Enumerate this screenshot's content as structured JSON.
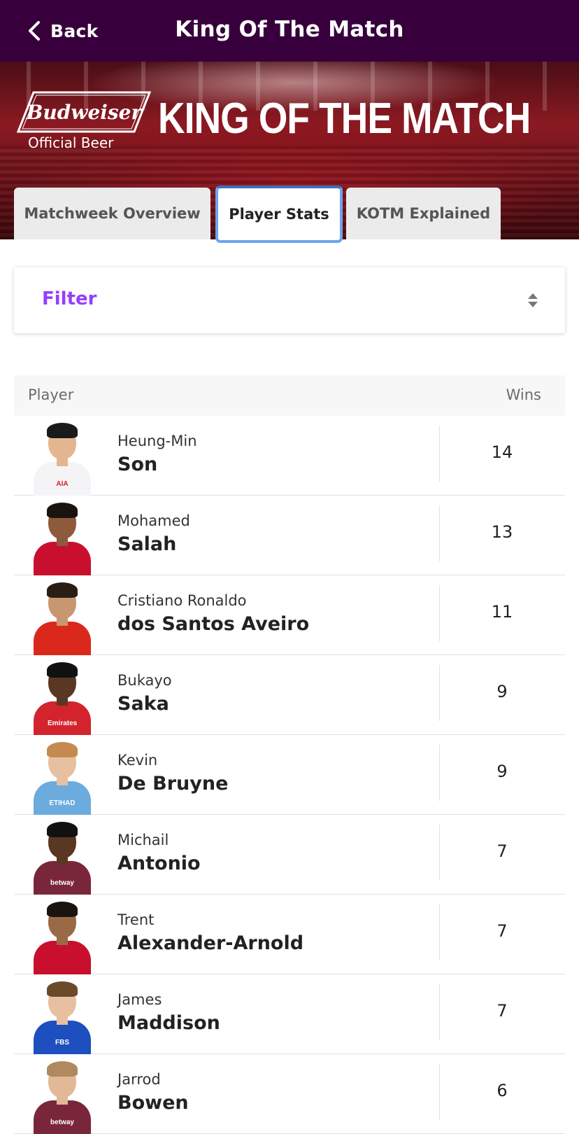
{
  "header": {
    "back_label": "Back",
    "title": "King Of The Match"
  },
  "banner": {
    "brand_name": "Budweiser",
    "brand_subtitle": "Official Beer",
    "heading": "KING OF THE MATCH"
  },
  "tabs": [
    {
      "label": "Matchweek Overview",
      "active": false
    },
    {
      "label": "Player Stats",
      "active": true
    },
    {
      "label": "KOTM Explained",
      "active": false
    }
  ],
  "filter": {
    "label": "Filter",
    "icon": "sort-icon"
  },
  "table": {
    "columns": {
      "player": "Player",
      "wins": "Wins"
    },
    "rows": [
      {
        "first_name": "Heung-Min",
        "last_name": "Son",
        "wins": "14",
        "kit_color": "#f4f4f6",
        "skin": "#e3b690",
        "hair": "#1a1a1a",
        "sponsor": "AIA",
        "sponsor_color": "#d6202f"
      },
      {
        "first_name": "Mohamed",
        "last_name": "Salah",
        "wins": "13",
        "kit_color": "#c8102e",
        "skin": "#8d5a3b",
        "hair": "#1a1410",
        "sponsor": "",
        "sponsor_color": "#ffffff"
      },
      {
        "first_name": "Cristiano Ronaldo",
        "last_name": "dos Santos Aveiro",
        "wins": "11",
        "kit_color": "#da291c",
        "skin": "#c99672",
        "hair": "#2a1d14",
        "sponsor": "",
        "sponsor_color": "#ffffff"
      },
      {
        "first_name": "Bukayo",
        "last_name": "Saka",
        "wins": "9",
        "kit_color": "#d3232c",
        "skin": "#5a3722",
        "hair": "#111111",
        "sponsor": "Emirates",
        "sponsor_color": "#ffffff"
      },
      {
        "first_name": "Kevin",
        "last_name": "De Bruyne",
        "wins": "9",
        "kit_color": "#6cabdd",
        "skin": "#e6c0a0",
        "hair": "#c58a50",
        "sponsor": "ETIHAD",
        "sponsor_color": "#ffffff"
      },
      {
        "first_name": "Michail",
        "last_name": "Antonio",
        "wins": "7",
        "kit_color": "#7a263a",
        "skin": "#5a3722",
        "hair": "#111111",
        "sponsor": "betway",
        "sponsor_color": "#ffffff"
      },
      {
        "first_name": "Trent",
        "last_name": "Alexander-Arnold",
        "wins": "7",
        "kit_color": "#c8102e",
        "skin": "#9a6a46",
        "hair": "#1a1410",
        "sponsor": "",
        "sponsor_color": "#ffffff"
      },
      {
        "first_name": "James",
        "last_name": "Maddison",
        "wins": "7",
        "kit_color": "#1d4fbf",
        "skin": "#e6c0a0",
        "hair": "#6b4a2a",
        "sponsor": "FBS",
        "sponsor_color": "#ffffff"
      },
      {
        "first_name": "Jarrod",
        "last_name": "Bowen",
        "wins": "6",
        "kit_color": "#7a263a",
        "skin": "#e2b896",
        "hair": "#b08a5e",
        "sponsor": "betway",
        "sponsor_color": "#ffffff"
      }
    ]
  },
  "colors": {
    "header_bg": "#37003c",
    "filter_accent": "#963cff",
    "active_tab_border": "#6aa5ee"
  }
}
